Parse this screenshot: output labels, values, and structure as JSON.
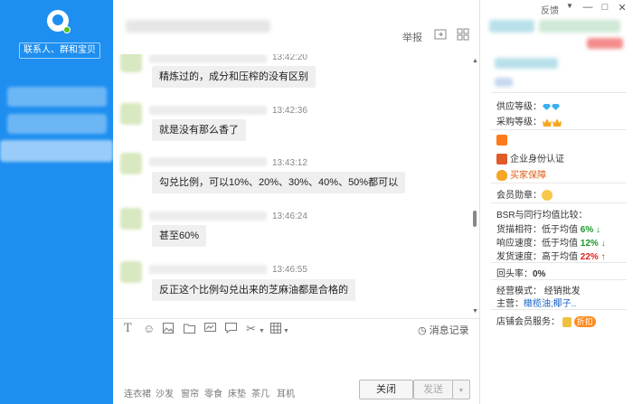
{
  "sidebar": {
    "search_placeholder": "联系人、群和宝贝"
  },
  "header": {
    "report_label": "举报",
    "share_icon": "share-icon",
    "apps_icon": "grid-icon"
  },
  "messages": [
    {
      "time": "13:42:20",
      "text": "精炼过的，成分和压榨的没有区别"
    },
    {
      "time": "13:42:36",
      "text": "就是没有那么香了"
    },
    {
      "time": "13:43:12",
      "text": "勾兑比例，可以10%、20%、30%、40%、50%都可以"
    },
    {
      "time": "13:46:24",
      "text": "甚至60%"
    },
    {
      "time": "13:46:55",
      "text": "反正这个比例勾兑出来的芝麻油都是合格的"
    }
  ],
  "input": {
    "history_label": "消息记录",
    "quick_phrases": [
      "连衣裙",
      "沙发",
      "窗帘",
      "零食",
      "床垫",
      "茶几",
      "耳机"
    ],
    "close_label": "关闭",
    "send_label": "发送"
  },
  "right_panel": {
    "feedback_label": "反馈",
    "supply_level_label": "供应等级：",
    "purchase_level_label": "采购等级：",
    "enterprise_cert": "企业身份认证",
    "buyer_protection": "买家保障",
    "member_medal_label": "会员勋章：",
    "bsr_heading": "BSR与同行均值比较：",
    "metrics": [
      {
        "label": "货描相符：",
        "compare": "低于均值",
        "value": "6%",
        "trend": "down"
      },
      {
        "label": "响应速度：",
        "compare": "低于均值",
        "value": "12%",
        "trend": "down"
      },
      {
        "label": "发货速度：",
        "compare": "高于均值",
        "value": "22%",
        "trend": "up"
      }
    ],
    "repeat_rate_label": "回头率：",
    "repeat_rate_value": "0%",
    "business_mode_label": "经营模式：",
    "business_mode_value": "经销批发",
    "main_business_label": "主营：",
    "main_business_value": "橄榄油;椰子..",
    "store_service_label": "店铺会员服务：",
    "promo_label": "折扣"
  },
  "colors": {
    "sidebar": "#1e8ff0",
    "down": "#1a9a2a",
    "up": "#e02020"
  }
}
